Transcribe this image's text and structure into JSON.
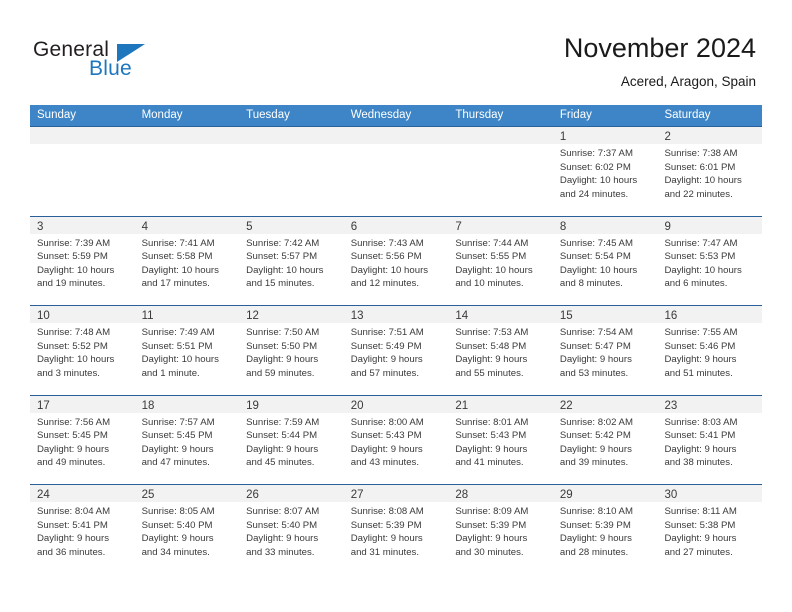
{
  "brand": {
    "name_part1": "General",
    "name_part2": "Blue",
    "accent_color": "#1e76bd"
  },
  "header": {
    "title": "November 2024",
    "subtitle": "Acered, Aragon, Spain"
  },
  "colors": {
    "header_bar": "#3d85c6",
    "row_border": "#2a6099",
    "day_band": "#f2f2f2",
    "text": "#3a3a3a"
  },
  "weekdays": [
    "Sunday",
    "Monday",
    "Tuesday",
    "Wednesday",
    "Thursday",
    "Friday",
    "Saturday"
  ],
  "weeks": [
    [
      {
        "empty": true
      },
      {
        "empty": true
      },
      {
        "empty": true
      },
      {
        "empty": true
      },
      {
        "empty": true
      },
      {
        "day": "1",
        "sunrise": "Sunrise: 7:37 AM",
        "sunset": "Sunset: 6:02 PM",
        "daylight1": "Daylight: 10 hours",
        "daylight2": "and 24 minutes."
      },
      {
        "day": "2",
        "sunrise": "Sunrise: 7:38 AM",
        "sunset": "Sunset: 6:01 PM",
        "daylight1": "Daylight: 10 hours",
        "daylight2": "and 22 minutes."
      }
    ],
    [
      {
        "day": "3",
        "sunrise": "Sunrise: 7:39 AM",
        "sunset": "Sunset: 5:59 PM",
        "daylight1": "Daylight: 10 hours",
        "daylight2": "and 19 minutes."
      },
      {
        "day": "4",
        "sunrise": "Sunrise: 7:41 AM",
        "sunset": "Sunset: 5:58 PM",
        "daylight1": "Daylight: 10 hours",
        "daylight2": "and 17 minutes."
      },
      {
        "day": "5",
        "sunrise": "Sunrise: 7:42 AM",
        "sunset": "Sunset: 5:57 PM",
        "daylight1": "Daylight: 10 hours",
        "daylight2": "and 15 minutes."
      },
      {
        "day": "6",
        "sunrise": "Sunrise: 7:43 AM",
        "sunset": "Sunset: 5:56 PM",
        "daylight1": "Daylight: 10 hours",
        "daylight2": "and 12 minutes."
      },
      {
        "day": "7",
        "sunrise": "Sunrise: 7:44 AM",
        "sunset": "Sunset: 5:55 PM",
        "daylight1": "Daylight: 10 hours",
        "daylight2": "and 10 minutes."
      },
      {
        "day": "8",
        "sunrise": "Sunrise: 7:45 AM",
        "sunset": "Sunset: 5:54 PM",
        "daylight1": "Daylight: 10 hours",
        "daylight2": "and 8 minutes."
      },
      {
        "day": "9",
        "sunrise": "Sunrise: 7:47 AM",
        "sunset": "Sunset: 5:53 PM",
        "daylight1": "Daylight: 10 hours",
        "daylight2": "and 6 minutes."
      }
    ],
    [
      {
        "day": "10",
        "sunrise": "Sunrise: 7:48 AM",
        "sunset": "Sunset: 5:52 PM",
        "daylight1": "Daylight: 10 hours",
        "daylight2": "and 3 minutes."
      },
      {
        "day": "11",
        "sunrise": "Sunrise: 7:49 AM",
        "sunset": "Sunset: 5:51 PM",
        "daylight1": "Daylight: 10 hours",
        "daylight2": "and 1 minute."
      },
      {
        "day": "12",
        "sunrise": "Sunrise: 7:50 AM",
        "sunset": "Sunset: 5:50 PM",
        "daylight1": "Daylight: 9 hours",
        "daylight2": "and 59 minutes."
      },
      {
        "day": "13",
        "sunrise": "Sunrise: 7:51 AM",
        "sunset": "Sunset: 5:49 PM",
        "daylight1": "Daylight: 9 hours",
        "daylight2": "and 57 minutes."
      },
      {
        "day": "14",
        "sunrise": "Sunrise: 7:53 AM",
        "sunset": "Sunset: 5:48 PM",
        "daylight1": "Daylight: 9 hours",
        "daylight2": "and 55 minutes."
      },
      {
        "day": "15",
        "sunrise": "Sunrise: 7:54 AM",
        "sunset": "Sunset: 5:47 PM",
        "daylight1": "Daylight: 9 hours",
        "daylight2": "and 53 minutes."
      },
      {
        "day": "16",
        "sunrise": "Sunrise: 7:55 AM",
        "sunset": "Sunset: 5:46 PM",
        "daylight1": "Daylight: 9 hours",
        "daylight2": "and 51 minutes."
      }
    ],
    [
      {
        "day": "17",
        "sunrise": "Sunrise: 7:56 AM",
        "sunset": "Sunset: 5:45 PM",
        "daylight1": "Daylight: 9 hours",
        "daylight2": "and 49 minutes."
      },
      {
        "day": "18",
        "sunrise": "Sunrise: 7:57 AM",
        "sunset": "Sunset: 5:45 PM",
        "daylight1": "Daylight: 9 hours",
        "daylight2": "and 47 minutes."
      },
      {
        "day": "19",
        "sunrise": "Sunrise: 7:59 AM",
        "sunset": "Sunset: 5:44 PM",
        "daylight1": "Daylight: 9 hours",
        "daylight2": "and 45 minutes."
      },
      {
        "day": "20",
        "sunrise": "Sunrise: 8:00 AM",
        "sunset": "Sunset: 5:43 PM",
        "daylight1": "Daylight: 9 hours",
        "daylight2": "and 43 minutes."
      },
      {
        "day": "21",
        "sunrise": "Sunrise: 8:01 AM",
        "sunset": "Sunset: 5:43 PM",
        "daylight1": "Daylight: 9 hours",
        "daylight2": "and 41 minutes."
      },
      {
        "day": "22",
        "sunrise": "Sunrise: 8:02 AM",
        "sunset": "Sunset: 5:42 PM",
        "daylight1": "Daylight: 9 hours",
        "daylight2": "and 39 minutes."
      },
      {
        "day": "23",
        "sunrise": "Sunrise: 8:03 AM",
        "sunset": "Sunset: 5:41 PM",
        "daylight1": "Daylight: 9 hours",
        "daylight2": "and 38 minutes."
      }
    ],
    [
      {
        "day": "24",
        "sunrise": "Sunrise: 8:04 AM",
        "sunset": "Sunset: 5:41 PM",
        "daylight1": "Daylight: 9 hours",
        "daylight2": "and 36 minutes."
      },
      {
        "day": "25",
        "sunrise": "Sunrise: 8:05 AM",
        "sunset": "Sunset: 5:40 PM",
        "daylight1": "Daylight: 9 hours",
        "daylight2": "and 34 minutes."
      },
      {
        "day": "26",
        "sunrise": "Sunrise: 8:07 AM",
        "sunset": "Sunset: 5:40 PM",
        "daylight1": "Daylight: 9 hours",
        "daylight2": "and 33 minutes."
      },
      {
        "day": "27",
        "sunrise": "Sunrise: 8:08 AM",
        "sunset": "Sunset: 5:39 PM",
        "daylight1": "Daylight: 9 hours",
        "daylight2": "and 31 minutes."
      },
      {
        "day": "28",
        "sunrise": "Sunrise: 8:09 AM",
        "sunset": "Sunset: 5:39 PM",
        "daylight1": "Daylight: 9 hours",
        "daylight2": "and 30 minutes."
      },
      {
        "day": "29",
        "sunrise": "Sunrise: 8:10 AM",
        "sunset": "Sunset: 5:39 PM",
        "daylight1": "Daylight: 9 hours",
        "daylight2": "and 28 minutes."
      },
      {
        "day": "30",
        "sunrise": "Sunrise: 8:11 AM",
        "sunset": "Sunset: 5:38 PM",
        "daylight1": "Daylight: 9 hours",
        "daylight2": "and 27 minutes."
      }
    ]
  ]
}
